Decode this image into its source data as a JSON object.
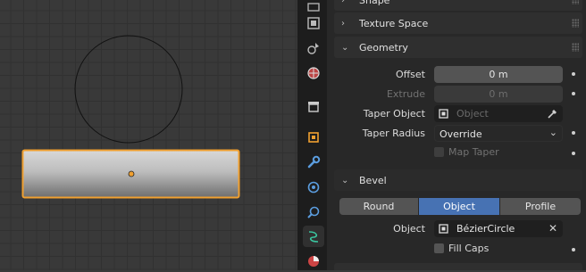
{
  "sections": {
    "shape": "Shape",
    "texture_space": "Texture Space",
    "geometry": "Geometry",
    "bevel": "Bevel"
  },
  "geometry": {
    "offset_label": "Offset",
    "offset_value": "0 m",
    "extrude_label": "Extrude",
    "extrude_value": "0 m",
    "taper_object_label": "Taper Object",
    "taper_object_placeholder": "Object",
    "taper_radius_label": "Taper Radius",
    "taper_radius_value": "Override",
    "map_taper_label": "Map Taper"
  },
  "bevel": {
    "modes": [
      "Round",
      "Object",
      "Profile"
    ],
    "active_mode": "Object",
    "object_label": "Object",
    "object_value": "BézierCircle",
    "fill_caps_label": "Fill Caps"
  },
  "tabs": [
    {
      "icon": "render-icon"
    },
    {
      "icon": "output-icon"
    },
    {
      "icon": "view-layer-icon"
    },
    {
      "icon": "scene-icon"
    },
    {
      "icon": "world-icon"
    },
    {
      "icon": "object-icon"
    },
    {
      "icon": "modifier-icon"
    },
    {
      "icon": "particles-icon"
    },
    {
      "icon": "physics-icon"
    },
    {
      "icon": "curve-data-icon"
    },
    {
      "icon": "material-icon"
    }
  ],
  "colors": {
    "selection_outline": "#f0a030",
    "active_button": "#4772b3",
    "active_tab_icon": "#3ac6a0"
  }
}
